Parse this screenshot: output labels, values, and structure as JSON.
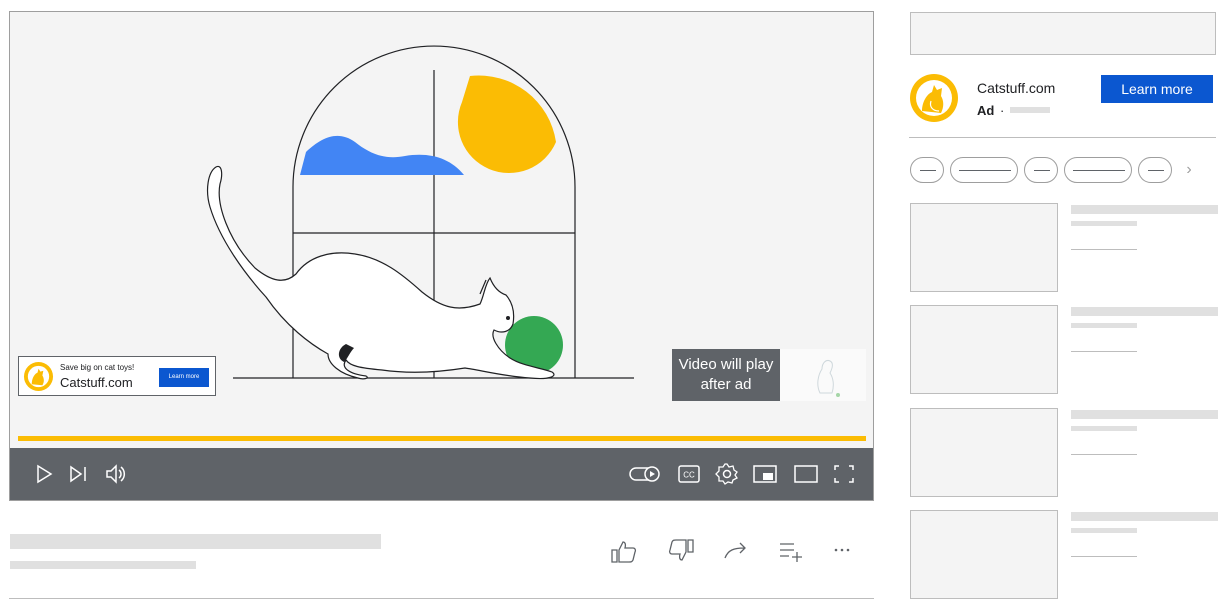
{
  "player": {
    "overlay_ad": {
      "headline": "Save big on cat toys!",
      "domain": "Catstuff.com",
      "cta_label": "Learn more"
    },
    "skip_notice": "Video will play after ad",
    "ad_progress": 1.0,
    "controls": {
      "left": [
        "play-icon",
        "skip-next-icon",
        "volume-icon"
      ],
      "right": [
        "autoplay-toggle-icon",
        "closed-captions-icon",
        "settings-gear-icon",
        "miniplayer-icon",
        "theater-mode-icon",
        "fullscreen-icon"
      ]
    },
    "captions_label": "CC"
  },
  "actions": [
    "like-icon",
    "dislike-icon",
    "share-icon",
    "save-to-playlist-icon",
    "more-options-icon"
  ],
  "sidebar": {
    "ad": {
      "domain": "Catstuff.com",
      "label": "Ad",
      "separator": "·",
      "cta_label": "Learn more"
    },
    "chip_count": 5,
    "chip_next_icon": "chevron-right-icon",
    "recommendation_count": 4
  },
  "colors": {
    "accent_blue": "#0b57d0",
    "ad_yellow": "#fbbc04",
    "control_bar": "#5f6368",
    "skeleton": "#e0e0e0"
  }
}
